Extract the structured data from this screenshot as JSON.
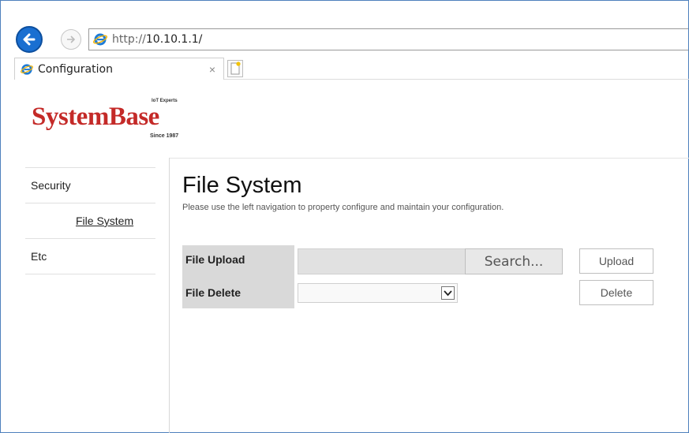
{
  "browser": {
    "address_proto": "http://",
    "address_host": "10.10.1.1/",
    "tab_title": "Configuration",
    "tab_close": "×"
  },
  "logo": {
    "brand": "SystemBase",
    "tagline": "IoT Experts",
    "since": "Since 1987",
    "color": "#c42a28"
  },
  "sidebar": {
    "items": [
      {
        "label": "Security"
      },
      {
        "label": "File System"
      },
      {
        "label": "Etc"
      }
    ]
  },
  "main": {
    "title": "File System",
    "description": "Please use the left navigation to property configure and maintain your configuration.",
    "upload_label": "File Upload",
    "delete_label": "File Delete",
    "search_button": "Search...",
    "upload_button": "Upload",
    "delete_button": "Delete",
    "delete_selected": ""
  }
}
